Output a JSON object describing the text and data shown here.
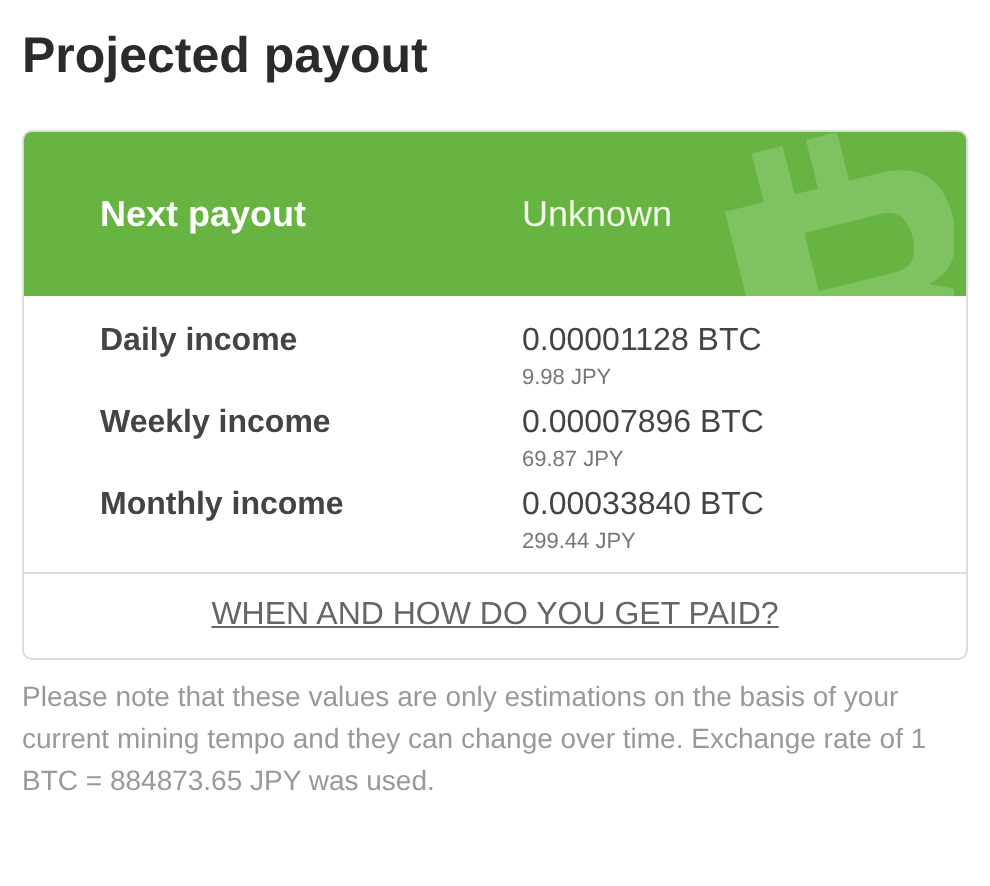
{
  "title": "Projected payout",
  "next_payout": {
    "label": "Next payout",
    "value": "Unknown"
  },
  "incomes": [
    {
      "label": "Daily income",
      "btc": "0.00001128 BTC",
      "fiat": "9.98 JPY"
    },
    {
      "label": "Weekly income",
      "btc": "0.00007896 BTC",
      "fiat": "69.87 JPY"
    },
    {
      "label": "Monthly income",
      "btc": "0.00033840 BTC",
      "fiat": "299.44 JPY"
    }
  ],
  "link": "WHEN AND HOW DO YOU GET PAID?",
  "note": "Please note that these values are only estimations on the basis of your current mining tempo and they can change over time. Exchange rate of 1 BTC = 884873.65 JPY was used."
}
